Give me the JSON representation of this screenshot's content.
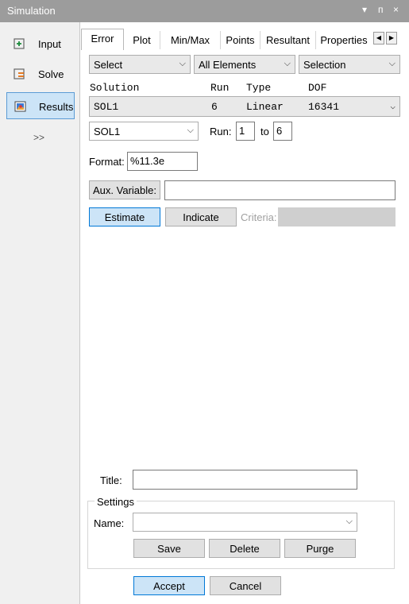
{
  "window": {
    "title": "Simulation",
    "ctrl_dropdown": "▾",
    "ctrl_pin": "ᴨ",
    "ctrl_close": "×"
  },
  "sidebar": {
    "items": [
      {
        "label": "Input",
        "icon": "input-icon"
      },
      {
        "label": "Solve",
        "icon": "solve-icon"
      },
      {
        "label": "Results",
        "icon": "results-icon"
      }
    ],
    "more": ">>"
  },
  "tabs": {
    "items": [
      "Error",
      "Plot",
      "Min/Max",
      "Points",
      "Resultant",
      "Properties"
    ],
    "active": "Error",
    "left_arrow": "◀",
    "right_arrow": "▶"
  },
  "filters": {
    "select": "Select",
    "elements": "All Elements",
    "selection": "Selection"
  },
  "solution_table": {
    "headers": [
      "Solution",
      "Run",
      "Type",
      "DOF"
    ],
    "row": [
      "SOL1",
      "6",
      "Linear",
      "16341"
    ]
  },
  "solution_select": "SOL1",
  "run": {
    "label": "Run:",
    "from": "1",
    "to_label": "to",
    "to": "6"
  },
  "format": {
    "label": "Format:",
    "value": "%11.3e"
  },
  "aux": {
    "button": "Aux. Variable:",
    "value": ""
  },
  "actions": {
    "estimate": "Estimate",
    "indicate": "Indicate",
    "criteria_label": "Criteria:",
    "criteria_value": ""
  },
  "title_field": {
    "label": "Title:",
    "value": ""
  },
  "settings": {
    "legend": "Settings",
    "name_label": "Name:",
    "name_value": "",
    "save": "Save",
    "delete": "Delete",
    "purge": "Purge"
  },
  "footer": {
    "accept": "Accept",
    "cancel": "Cancel"
  },
  "colors": {
    "titlebar": "#9c9c9c",
    "active_bg": "#cce4f7",
    "active_border": "#5b9bd5"
  }
}
